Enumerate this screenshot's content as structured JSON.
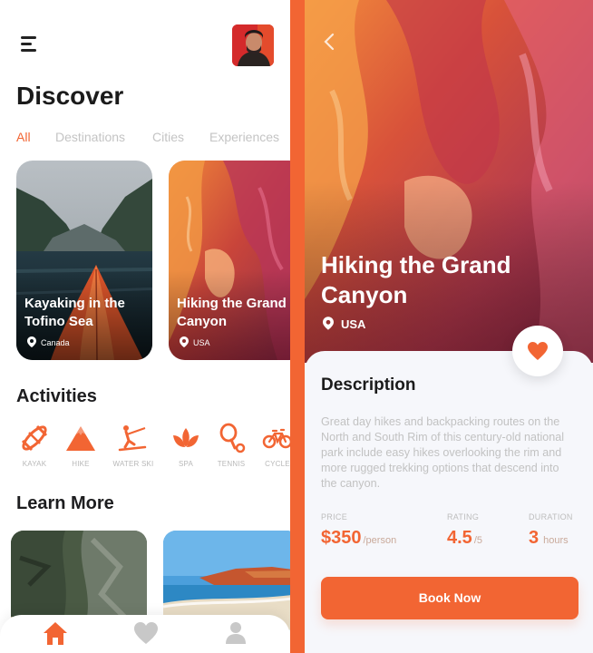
{
  "discover": {
    "title": "Discover",
    "tabs": [
      {
        "label": "All",
        "active": true
      },
      {
        "label": "Destinations",
        "active": false
      },
      {
        "label": "Cities",
        "active": false
      },
      {
        "label": "Experiences",
        "active": false
      }
    ],
    "cards": [
      {
        "title": "Kayaking in the Tofino Sea",
        "location": "Canada"
      },
      {
        "title": "Hiking the Grand Canyon",
        "location": "USA"
      }
    ],
    "activities_title": "Activities",
    "activities": [
      {
        "label": "KAYAK",
        "icon": "kayak-icon"
      },
      {
        "label": "HIKE",
        "icon": "mountain-icon"
      },
      {
        "label": "WATER SKI",
        "icon": "water-ski-icon"
      },
      {
        "label": "SPA",
        "icon": "lotus-icon"
      },
      {
        "label": "TENNIS",
        "icon": "tennis-racket-icon"
      },
      {
        "label": "CYCLE",
        "icon": "bicycle-icon"
      }
    ],
    "learn_title": "Learn More",
    "nav": [
      "home-icon",
      "heart-icon",
      "profile-icon"
    ]
  },
  "detail": {
    "title": "Hiking the Grand Canyon",
    "location": "USA",
    "description_title": "Description",
    "description": "Great day hikes and backpacking routes on the North and South Rim of this century-old national park include easy hikes overlooking the rim and more rugged trekking options that descend into the canyon.",
    "stats": [
      {
        "label": "PRICE",
        "value": "$350",
        "unit": "/person"
      },
      {
        "label": "RATING",
        "value": "4.5",
        "unit": "/5"
      },
      {
        "label": "DURATION",
        "value": "3",
        "unit": "hours"
      }
    ],
    "book_label": "Book Now"
  },
  "colors": {
    "accent": "#f26533",
    "title": "#1b1b1b",
    "muted": "#c2c2c2"
  }
}
